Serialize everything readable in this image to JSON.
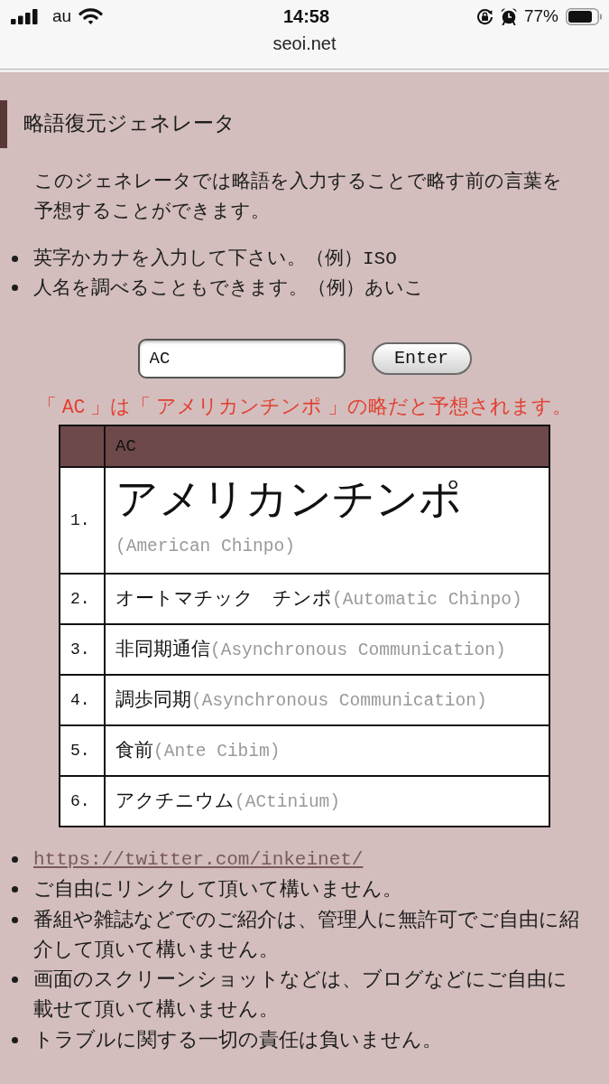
{
  "status_bar": {
    "carrier": "au",
    "time": "14:58",
    "battery": "77%"
  },
  "address_bar": {
    "url": "seoi.net"
  },
  "heading": "略語復元ジェネレータ",
  "intro": "このジェネレータでは略語を入力することで略す前の言葉を予想することができます。",
  "tips": [
    {
      "segments": [
        {
          "kind": "plain",
          "text": "英字かカナを入力して下さい。（例）"
        },
        {
          "kind": "code",
          "text": "ISO"
        }
      ]
    },
    {
      "segments": [
        {
          "kind": "plain",
          "text": "人名を調べることもできます。（例）あいこ"
        }
      ]
    }
  ],
  "search": {
    "value": "AC",
    "button": "Enter"
  },
  "result_message": {
    "segments": [
      {
        "kind": "plain",
        "text": "「 "
      },
      {
        "kind": "code",
        "text": "AC"
      },
      {
        "kind": "plain",
        "text": " 」は「 アメリカンチンポ 」の略だと予想されます。"
      }
    ]
  },
  "table": {
    "header": "AC",
    "rows": [
      {
        "kind": "top",
        "rank": "1.",
        "word": "アメリカンチンポ",
        "reading": "(American Chinpo)"
      },
      {
        "kind": "normal",
        "rank": "2.",
        "word": "オートマチック　チンポ",
        "reading": "(Automatic Chinpo)"
      },
      {
        "kind": "normal",
        "rank": "3.",
        "word": "非同期通信",
        "reading": "(Asynchronous Communication)"
      },
      {
        "kind": "normal",
        "rank": "4.",
        "word": "調歩同期",
        "reading": "(Asynchronous Communication)"
      },
      {
        "kind": "normal",
        "rank": "5.",
        "word": "食前",
        "reading": "(Ante Cibim)"
      },
      {
        "kind": "normal",
        "rank": "6.",
        "word": "アクチニウム",
        "reading": "(ACtinium)"
      }
    ]
  },
  "notes": [
    {
      "kind": "link",
      "text": "https://twitter.com/inkeinet/"
    },
    {
      "kind": "text",
      "text": "ご自由にリンクして頂いて構いません。"
    },
    {
      "kind": "text",
      "text": "番組や雑誌などでのご紹介は、管理人に無許可でご自由に紹介して頂いて構いません。"
    },
    {
      "kind": "text",
      "text": "画面のスクリーンショットなどは、ブログなどにご自由に載せて頂いて構いません。"
    },
    {
      "kind": "text",
      "text": "トラブルに関する一切の責任は負いません。"
    }
  ]
}
